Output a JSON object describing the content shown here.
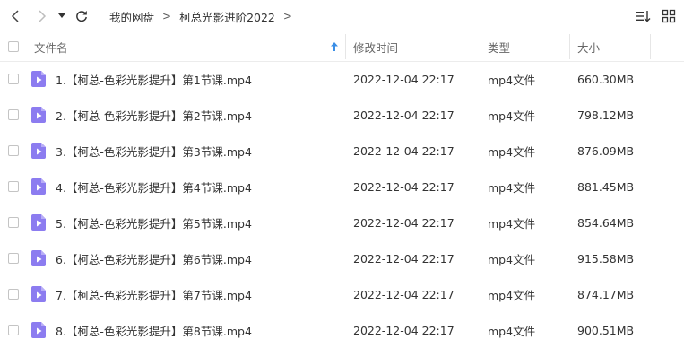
{
  "breadcrumb": {
    "items": [
      "我的网盘",
      "柯总光影进阶2022"
    ],
    "separator": ">"
  },
  "columns": {
    "name": "文件名",
    "modified": "修改时间",
    "type": "类型",
    "size": "大小"
  },
  "files": [
    {
      "name": "1.【柯总-色彩光影提升】第1节课.mp4",
      "modified": "2022-12-04 22:17",
      "type": "mp4文件",
      "size": "660.30MB"
    },
    {
      "name": "2.【柯总-色彩光影提升】第2节课.mp4",
      "modified": "2022-12-04 22:17",
      "type": "mp4文件",
      "size": "798.12MB"
    },
    {
      "name": "3.【柯总-色彩光影提升】第3节课.mp4",
      "modified": "2022-12-04 22:17",
      "type": "mp4文件",
      "size": "876.09MB"
    },
    {
      "name": "4.【柯总-色彩光影提升】第4节课.mp4",
      "modified": "2022-12-04 22:17",
      "type": "mp4文件",
      "size": "881.45MB"
    },
    {
      "name": "5.【柯总-色彩光影提升】第5节课.mp4",
      "modified": "2022-12-04 22:17",
      "type": "mp4文件",
      "size": "854.64MB"
    },
    {
      "name": "6.【柯总-色彩光影提升】第6节课.mp4",
      "modified": "2022-12-04 22:17",
      "type": "mp4文件",
      "size": "915.58MB"
    },
    {
      "name": "7.【柯总-色彩光影提升】第7节课.mp4",
      "modified": "2022-12-04 22:17",
      "type": "mp4文件",
      "size": "874.17MB"
    },
    {
      "name": "8.【柯总-色彩光影提升】第8节课.mp4",
      "modified": "2022-12-04 22:17",
      "type": "mp4文件",
      "size": "900.51MB"
    }
  ],
  "icons": {
    "back": "chevron-left-icon",
    "forward": "chevron-right-icon",
    "history": "caret-down-icon",
    "refresh": "refresh-icon",
    "sort": "sort-icon",
    "view": "grid-view-icon",
    "sort_indicator": "arrow-up-icon",
    "file": "video-file-icon"
  },
  "colors": {
    "file_icon": "#8c7cf0",
    "sort_arrow": "#3a8ee6"
  }
}
